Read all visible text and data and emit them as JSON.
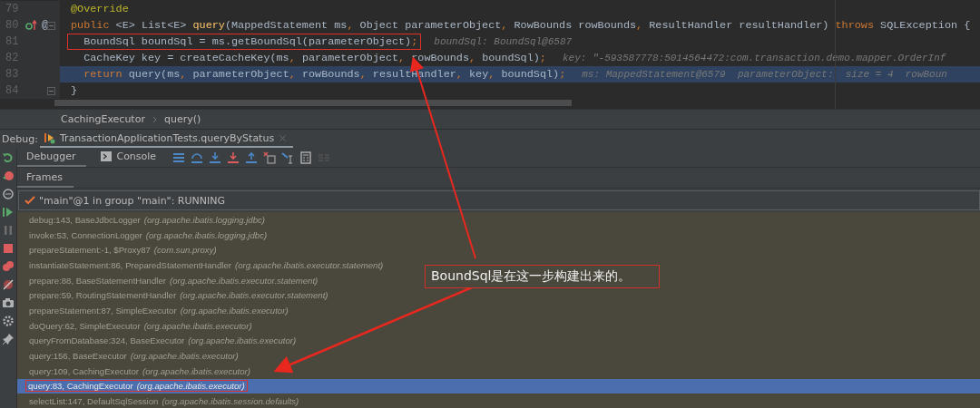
{
  "editor": {
    "lines": [
      {
        "number": "79",
        "fold": false,
        "current": false,
        "boxed": false,
        "tokens": [
          {
            "kind": "annotation",
            "text": "@Override"
          }
        ]
      },
      {
        "number": "80",
        "fold": true,
        "current": false,
        "boxed": false,
        "override": true,
        "gutter_mark": "@",
        "tokens": [
          {
            "kind": "keyword",
            "text": "public "
          },
          {
            "kind": "plain",
            "text": "<E> List<E> "
          },
          {
            "kind": "method",
            "text": "query"
          },
          {
            "kind": "plain",
            "text": "(MappedStatement ms"
          },
          {
            "kind": "comma",
            "text": ","
          },
          {
            "kind": "plain",
            "text": " Object parameterObject"
          },
          {
            "kind": "comma",
            "text": ","
          },
          {
            "kind": "plain",
            "text": " RowBounds rowBounds"
          },
          {
            "kind": "comma",
            "text": ","
          },
          {
            "kind": "plain",
            "text": " ResultHandler resultHandler) "
          },
          {
            "kind": "keyword",
            "text": "throws"
          },
          {
            "kind": "plain",
            "text": " SQLException {"
          }
        ]
      },
      {
        "number": "81",
        "fold": false,
        "current": false,
        "boxed": true,
        "tokens": [
          {
            "kind": "plain",
            "text": "  BoundSql boundSql = ms.getBoundSql(parameterObject)"
          },
          {
            "kind": "comma",
            "text": ";"
          }
        ],
        "hint": "boundSql: BoundSql@6587"
      },
      {
        "number": "82",
        "fold": false,
        "current": false,
        "boxed": false,
        "tokens": [
          {
            "kind": "plain",
            "text": "  CacheKey key = createCacheKey(ms"
          },
          {
            "kind": "comma",
            "text": ","
          },
          {
            "kind": "plain",
            "text": " parameterObject"
          },
          {
            "kind": "comma",
            "text": ","
          },
          {
            "kind": "plain",
            "text": " rowBounds"
          },
          {
            "kind": "comma",
            "text": ","
          },
          {
            "kind": "plain",
            "text": " boundSql)"
          },
          {
            "kind": "comma",
            "text": ";"
          }
        ],
        "hint": "key: \"-593587778:5014564472:com.transaction.demo.mapper.OrderInf"
      },
      {
        "number": "83",
        "fold": false,
        "current": true,
        "boxed": false,
        "tokens": [
          {
            "kind": "keyword",
            "text": "  return "
          },
          {
            "kind": "plain",
            "text": "query(ms"
          },
          {
            "kind": "comma",
            "text": ","
          },
          {
            "kind": "plain",
            "text": " parameterObject"
          },
          {
            "kind": "comma",
            "text": ","
          },
          {
            "kind": "plain",
            "text": " rowBounds"
          },
          {
            "kind": "comma",
            "text": ","
          },
          {
            "kind": "plain",
            "text": " resultHandler"
          },
          {
            "kind": "comma",
            "text": ","
          },
          {
            "kind": "plain",
            "text": " key"
          },
          {
            "kind": "comma",
            "text": ","
          },
          {
            "kind": "plain",
            "text": " boundSql)"
          },
          {
            "kind": "comma",
            "text": ";"
          }
        ],
        "hint": "ms: MappedStatement@6579  parameterObject:  size = 4  rowBoun"
      },
      {
        "number": "84",
        "fold": true,
        "current": false,
        "boxed": false,
        "tokens": [
          {
            "kind": "plain",
            "text": "}"
          }
        ]
      }
    ]
  },
  "breadcrumb": [
    "CachingExecutor",
    "query()"
  ],
  "debug_bar": {
    "label": "Debug:",
    "tab": "TransactionApplicationTests.queryByStatus"
  },
  "tabs": [
    {
      "label": "Debugger",
      "selected": true,
      "kind": "debugger"
    },
    {
      "label": "Console",
      "selected": false,
      "kind": "console"
    }
  ],
  "frames_tab": {
    "label": "Frames",
    "selected": true
  },
  "thread": "\"main\"@1 in group \"main\": RUNNING",
  "frames": [
    {
      "method": "debug:143, BaseJdbcLogger",
      "package": "(org.apache.ibatis.logging.jdbc)",
      "selected": false,
      "boxed": false
    },
    {
      "method": "invoke:53, ConnectionLogger",
      "package": "(org.apache.ibatis.logging.jdbc)",
      "selected": false,
      "boxed": false
    },
    {
      "method": "prepareStatement:-1, $Proxy87",
      "package": "(com.sun.proxy)",
      "selected": false,
      "boxed": false
    },
    {
      "method": "instantiateStatement:86, PreparedStatementHandler",
      "package": "(org.apache.ibatis.executor.statement)",
      "selected": false,
      "boxed": false
    },
    {
      "method": "prepare:88, BaseStatementHandler",
      "package": "(org.apache.ibatis.executor.statement)",
      "selected": false,
      "boxed": false
    },
    {
      "method": "prepare:59, RoutingStatementHandler",
      "package": "(org.apache.ibatis.executor.statement)",
      "selected": false,
      "boxed": false
    },
    {
      "method": "prepareStatement:87, SimpleExecutor",
      "package": "(org.apache.ibatis.executor)",
      "selected": false,
      "boxed": false
    },
    {
      "method": "doQuery:62, SimpleExecutor",
      "package": "(org.apache.ibatis.executor)",
      "selected": false,
      "boxed": false
    },
    {
      "method": "queryFromDatabase:324, BaseExecutor",
      "package": "(org.apache.ibatis.executor)",
      "selected": false,
      "boxed": false
    },
    {
      "method": "query:156, BaseExecutor",
      "package": "(org.apache.ibatis.executor)",
      "selected": false,
      "boxed": false
    },
    {
      "method": "query:109, CachingExecutor",
      "package": "(org.apache.ibatis.executor)",
      "selected": false,
      "boxed": false
    },
    {
      "method": "query:83, CachingExecutor",
      "package": "(org.apache.ibatis.executor)",
      "selected": true,
      "boxed": true
    },
    {
      "method": "selectList:147, DefaultSqlSession",
      "package": "(org.apache.ibatis.session.defaults)",
      "selected": false,
      "boxed": false
    }
  ],
  "callout": {
    "text": "BoundSql是在这一步构建出来的。"
  }
}
